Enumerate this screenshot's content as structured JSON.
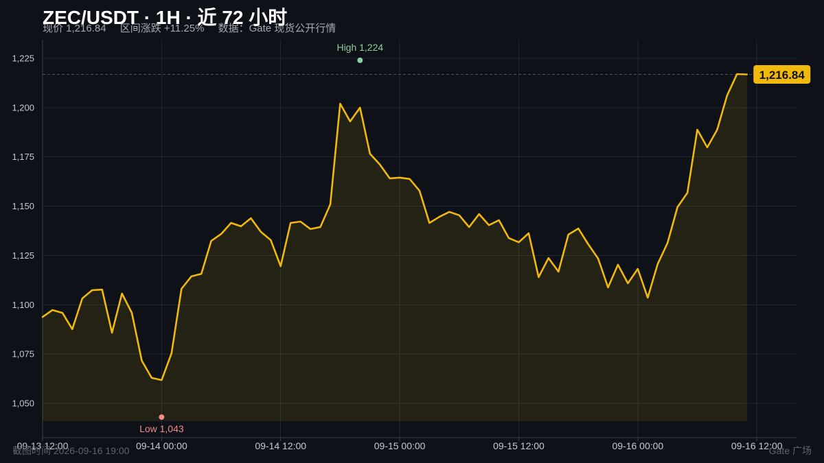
{
  "colors": {
    "line": "#f0b90b",
    "price_tag": "#f0b90b"
  },
  "footer": {
    "captured_at": "截图时间 2026-09-16 19:00",
    "brand": "Gate 广场"
  },
  "chart_data": {
    "type": "area",
    "title": "ZEC/USDT · 1H · 近 72 小时",
    "subtitle": [
      "现价 1,216.84",
      "区间涨跌 +11.25%",
      "数据：Gate 现货公开行情"
    ],
    "xlabel": "",
    "ylabel": "",
    "grid": true,
    "xlim": [
      "09-13 12:00",
      "09-16 16:00"
    ],
    "ylim": [
      1032.6,
      1234.4
    ],
    "x_ticks": [
      "09-13 12:00",
      "09-14 00:00",
      "09-14 12:00",
      "09-15 00:00",
      "09-15 12:00",
      "09-16 00:00",
      "09-16 12:00"
    ],
    "y_ticks": [
      "1,225",
      "1,200",
      "1,175",
      "1,150",
      "1,125",
      "1,100",
      "1,075",
      "1,050"
    ],
    "x": [
      "09-13 12:00",
      "09-13 13:00",
      "09-13 14:00",
      "09-13 15:00",
      "09-13 16:00",
      "09-13 17:00",
      "09-13 18:00",
      "09-13 19:00",
      "09-13 20:00",
      "09-13 21:00",
      "09-13 22:00",
      "09-13 23:00",
      "09-14 00:00",
      "09-14 01:00",
      "09-14 02:00",
      "09-14 03:00",
      "09-14 04:00",
      "09-14 05:00",
      "09-14 06:00",
      "09-14 07:00",
      "09-14 08:00",
      "09-14 09:00",
      "09-14 10:00",
      "09-14 11:00",
      "09-14 12:00",
      "09-14 13:00",
      "09-14 14:00",
      "09-14 15:00",
      "09-14 16:00",
      "09-14 17:00",
      "09-14 18:00",
      "09-14 19:00",
      "09-14 20:00",
      "09-14 21:00",
      "09-14 22:00",
      "09-14 23:00",
      "09-15 00:00",
      "09-15 01:00",
      "09-15 02:00",
      "09-15 03:00",
      "09-15 04:00",
      "09-15 05:00",
      "09-15 06:00",
      "09-15 07:00",
      "09-15 08:00",
      "09-15 09:00",
      "09-15 10:00",
      "09-15 11:00",
      "09-15 12:00",
      "09-15 13:00",
      "09-15 14:00",
      "09-15 15:00",
      "09-15 16:00",
      "09-15 17:00",
      "09-15 18:00",
      "09-15 19:00",
      "09-15 20:00",
      "09-15 21:00",
      "09-15 22:00",
      "09-15 23:00",
      "09-16 00:00",
      "09-16 01:00",
      "09-16 02:00",
      "09-16 03:00",
      "09-16 04:00",
      "09-16 05:00",
      "09-16 06:00",
      "09-16 07:00",
      "09-16 08:00",
      "09-16 09:00",
      "09-16 10:00",
      "09-16 11:00"
    ],
    "y": [
      1093.8,
      1097.3,
      1095.9,
      1087.6,
      1103.2,
      1107.4,
      1107.7,
      1085.8,
      1105.7,
      1095.9,
      1071.6,
      1062.9,
      1061.8,
      1075.4,
      1108.1,
      1114.4,
      1115.7,
      1132.4,
      1135.9,
      1141.5,
      1139.8,
      1143.9,
      1137.0,
      1132.8,
      1119.6,
      1141.5,
      1142.2,
      1138.4,
      1139.4,
      1150.9,
      1202.0,
      1193.0,
      1200.0,
      1176.6,
      1171.1,
      1164.1,
      1164.5,
      1163.8,
      1157.8,
      1141.5,
      1144.6,
      1147.1,
      1145.4,
      1139.4,
      1146.0,
      1140.4,
      1142.9,
      1133.8,
      1131.7,
      1136.3,
      1114.0,
      1123.7,
      1116.8,
      1135.6,
      1138.7,
      1130.7,
      1123.4,
      1108.8,
      1120.3,
      1110.9,
      1118.2,
      1103.6,
      1120.6,
      1131.4,
      1149.5,
      1156.8,
      1188.8,
      1179.8,
      1188.8,
      1206.2,
      1217.0,
      1216.84
    ],
    "last_price": {
      "value": 1216.84,
      "label": "1,216.84"
    },
    "annotations": [
      {
        "label": "High 1,224",
        "x": "09-14 20:00",
        "y": 1224,
        "color": "#8fd19e"
      },
      {
        "label": "Low 1,043",
        "x": "09-14 00:00",
        "y": 1043,
        "color": "#f08c8c"
      }
    ]
  }
}
